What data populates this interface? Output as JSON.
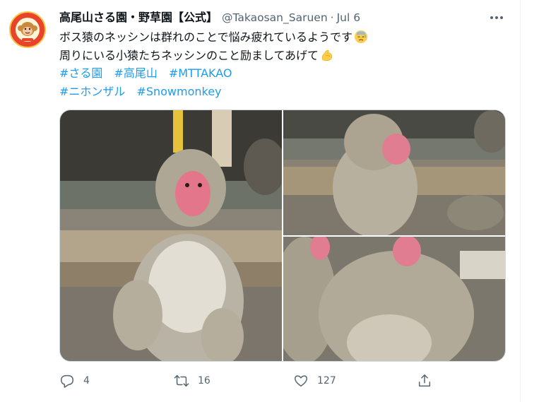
{
  "tweet": {
    "display_name": "高尾山さる園・野草園【公式】",
    "handle": "@Takaosan_Saruen",
    "separator": "·",
    "date": "Jul 6",
    "line1": "ボス猿のネッシンは群れのことで悩み疲れているようです",
    "line2": "周りにいる小猿たちネッシンのこと励ましてあげて",
    "hashtags_row1": [
      "#さる園",
      "#高尾山",
      "#MTTAKAO"
    ],
    "hashtags_row2": [
      "#ニホンザル",
      "#Snowmonkey"
    ],
    "emoji1": "downcast-sweat-face",
    "emoji2": "flexed-biceps"
  },
  "actions": {
    "reply_count": "4",
    "retweet_count": "16",
    "like_count": "127"
  },
  "colors": {
    "link": "#1d9bf0",
    "secondary_text": "#536471",
    "primary_text": "#0f1419"
  }
}
